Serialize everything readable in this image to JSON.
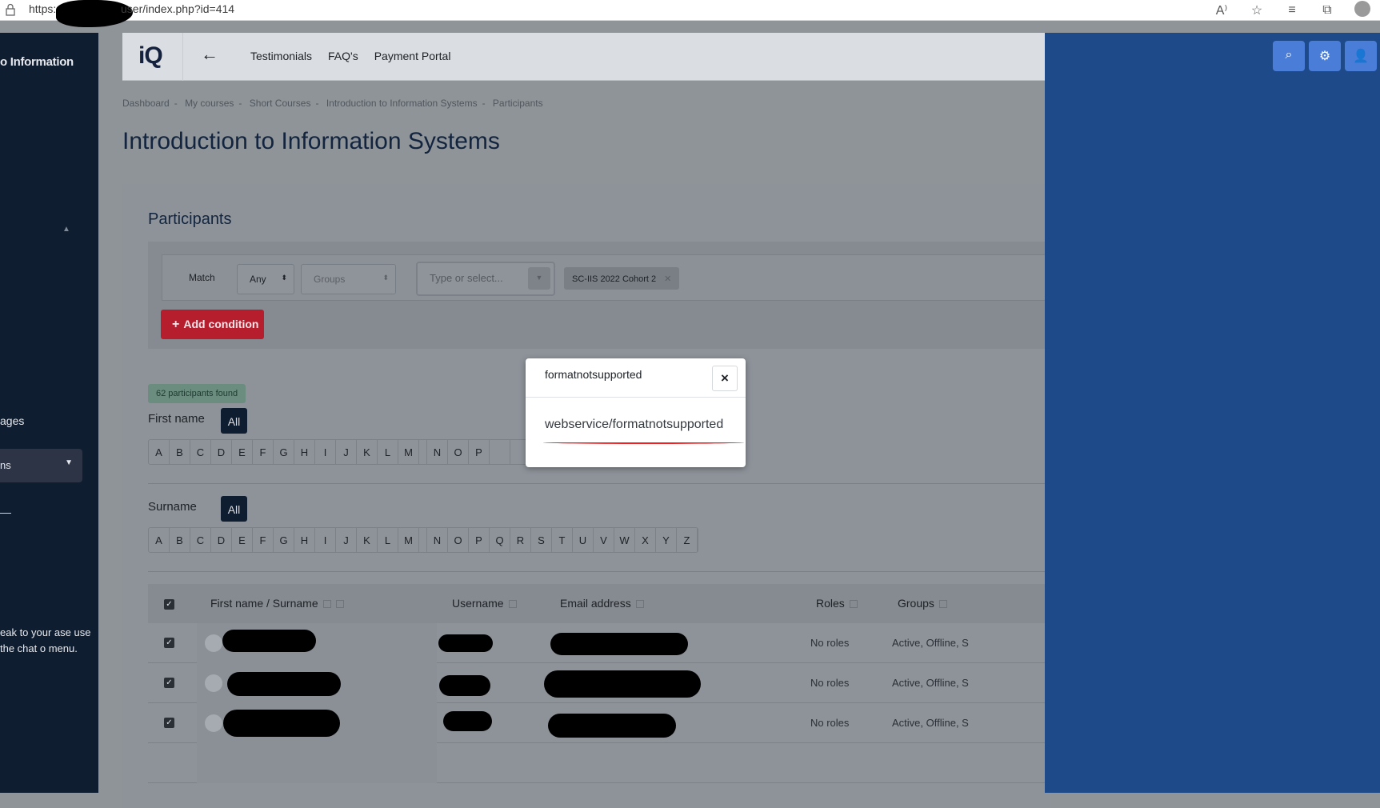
{
  "browser": {
    "url_start": "https:",
    "url_end": "user/index.php?id=414"
  },
  "sidebar": {
    "title": "o Information",
    "ages_label": "ages",
    "dropdown_label": "ns",
    "help_text": "eak to your ase use the chat o menu."
  },
  "topnav": {
    "logo": "iQ",
    "links": [
      "Testimonials",
      "FAQ's",
      "Payment Portal"
    ]
  },
  "breadcrumb": [
    "Dashboard",
    "My courses",
    "Short Courses",
    "Introduction to Information Systems",
    "Participants"
  ],
  "page_title": "Introduction to Information Systems",
  "participants": {
    "heading": "Participants",
    "match_label": "Match",
    "match_value": "Any",
    "groups_placeholder": "Groups",
    "type_placeholder": "Type or select...",
    "tag": "SC-IIS 2022 Cohort 2",
    "add_condition": "Add condition",
    "found": "62 participants found",
    "firstname_label": "First name",
    "surname_label": "Surname",
    "all_label": "All",
    "letters_first": [
      "A",
      "B",
      "C",
      "D",
      "E",
      "F",
      "G",
      "H",
      "I",
      "J",
      "K",
      "L",
      "M"
    ],
    "letters_second_firstname": [
      "N",
      "O",
      "P"
    ],
    "letters_second_surname": [
      "N",
      "O",
      "P",
      "Q",
      "R",
      "S",
      "T",
      "U",
      "V",
      "W",
      "X",
      "Y",
      "Z"
    ]
  },
  "table": {
    "headers": {
      "name": "First name / Surname",
      "username": "Username",
      "email": "Email address",
      "roles": "Roles",
      "groups": "Groups"
    },
    "rows": [
      {
        "roles": "No roles",
        "groups": "Active, Offline, S"
      },
      {
        "roles": "No roles",
        "groups": "Active, Offline, S"
      },
      {
        "roles": "No roles",
        "groups": "Active, Offline, S"
      }
    ]
  },
  "modal": {
    "title": "formatnotsupported",
    "message": "webservice/formatnotsupported",
    "close_symbol": "×"
  },
  "colors": {
    "accent_red": "#b61e2e",
    "drawer_blue": "#1f4a8a",
    "drawer_button": "#4a7dd8",
    "sidebar_dark": "#0f1d30"
  },
  "icons": {
    "drawer": [
      "search-icon",
      "gear-icon",
      "user-icon"
    ]
  }
}
